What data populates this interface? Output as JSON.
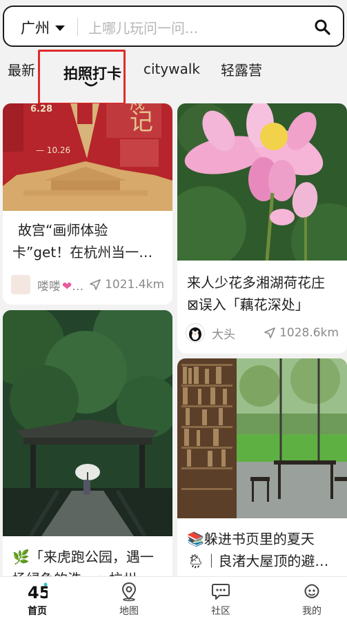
{
  "search": {
    "city": "广州",
    "placeholder": "上哪儿玩问一问..."
  },
  "tabs": [
    "最新",
    "拍照打卡",
    "citywalk",
    "轻露营"
  ],
  "feed": [
    {
      "title_lines": [
        "故宫“画师体验",
        "卡”get！在杭州当一…"
      ],
      "author": "喽喽",
      "distance": "1021.4km",
      "poster_text": {
        "date": "6.28 — 10.26",
        "big": "戍记"
      }
    },
    {
      "title_lines": [
        "来人少花多湘湖荷花庄",
        "⊠误入「藕花深处」"
      ],
      "author": "大头",
      "distance": "1028.6km"
    },
    {
      "title_lines": [
        "🌿「来虎跑公园，遇一",
        "场绿色的洗…」杭州"
      ],
      "author": "",
      "distance": ""
    },
    {
      "title_lines": [
        "📚躲进书页里的夏天",
        "🌦｜良渚大屋顶的避…"
      ],
      "author": "",
      "distance": ""
    }
  ],
  "nav": [
    {
      "label": "首页",
      "active": true
    },
    {
      "label": "地图",
      "active": false
    },
    {
      "label": "社区",
      "active": false
    },
    {
      "label": "我的",
      "active": false
    }
  ],
  "colors": {
    "highlight_box": "#e02a2a",
    "heart": "#e85a9a",
    "poster_red": "#b5252b"
  }
}
